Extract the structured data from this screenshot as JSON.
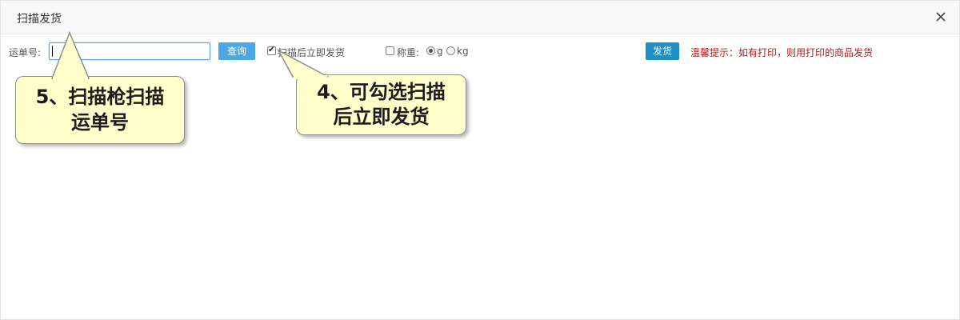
{
  "dialog": {
    "title": "扫描发货",
    "close_icon": "close-icon"
  },
  "toolbar": {
    "waybill_label": "运单号:",
    "waybill_value": "",
    "query_button": "查询",
    "scan_ship_checkbox": {
      "label": "扫描后立即发货",
      "checked": true
    },
    "weigh_checkbox": {
      "label": "称重:",
      "checked": false
    },
    "unit_options": [
      {
        "label": "g",
        "selected": true
      },
      {
        "label": "kg",
        "selected": false
      }
    ],
    "ship_button": "发货",
    "tip": "温馨提示：如有打印，则用打印的商品发货"
  },
  "callouts": [
    {
      "line1": "5、扫描枪扫描",
      "line2": "运单号"
    },
    {
      "line1": "4、可勾选扫描",
      "line2": "后立即发货"
    }
  ],
  "colors": {
    "query_button": "#4aa8e6",
    "ship_button": "#1f8fc7",
    "tip_text": "#b21b1b",
    "callout_fill": "#ffffcc"
  }
}
